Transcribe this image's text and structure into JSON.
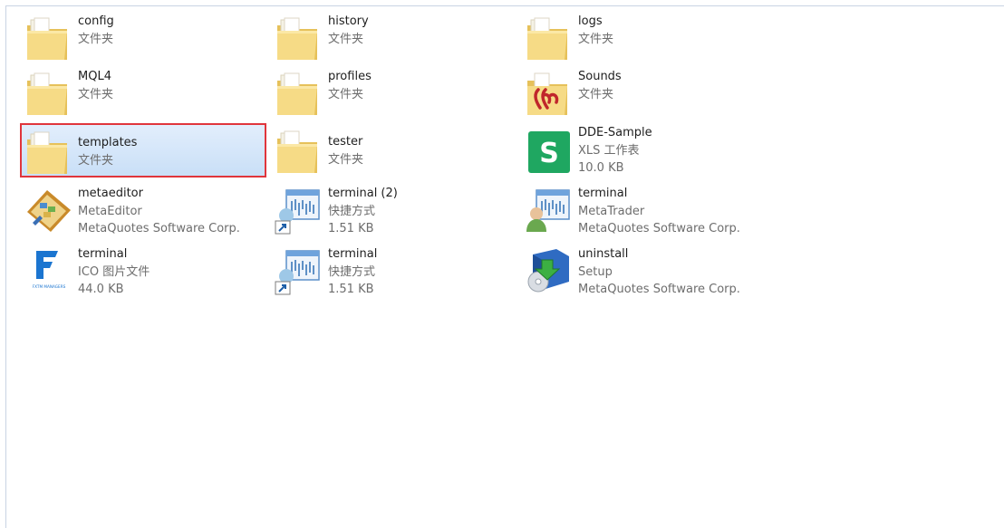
{
  "items": [
    {
      "name": "config",
      "type": "文件夹",
      "icon": "folder-icon"
    },
    {
      "name": "history",
      "type": "文件夹",
      "icon": "folder-icon"
    },
    {
      "name": "logs",
      "type": "文件夹",
      "icon": "folder-icon"
    },
    {
      "name": "MQL4",
      "type": "文件夹",
      "icon": "folder-icon"
    },
    {
      "name": "profiles",
      "type": "文件夹",
      "icon": "folder-icon"
    },
    {
      "name": "Sounds",
      "type": "文件夹",
      "icon": "sounds-folder-icon"
    },
    {
      "name": "templates",
      "type": "文件夹",
      "icon": "folder-icon",
      "selected": true
    },
    {
      "name": "tester",
      "type": "文件夹",
      "icon": "folder-icon"
    },
    {
      "name": "DDE-Sample",
      "type": "XLS 工作表",
      "detail": "10.0 KB",
      "icon": "xls-icon"
    },
    {
      "name": "metaeditor",
      "type": "MetaEditor",
      "detail": "MetaQuotes Software Corp.",
      "icon": "metaeditor-icon"
    },
    {
      "name": "terminal (2)",
      "type": "快捷方式",
      "detail": "1.51 KB",
      "icon": "shortcut-icon"
    },
    {
      "name": "terminal",
      "type": "MetaTrader",
      "detail": "MetaQuotes Software Corp.",
      "icon": "terminal-app-icon"
    },
    {
      "name": "terminal",
      "type": "ICO 图片文件",
      "detail": "44.0 KB",
      "icon": "ico-file-icon"
    },
    {
      "name": "terminal",
      "type": "快捷方式",
      "detail": "1.51 KB",
      "icon": "shortcut-icon"
    },
    {
      "name": "uninstall",
      "type": "Setup",
      "detail": "MetaQuotes Software Corp.",
      "icon": "uninstall-icon"
    }
  ],
  "ico_logo_text": "FXTM MANAGERS",
  "xls_glyph": "S",
  "colors": {
    "selection_border": "#e0353c",
    "selection_fill": "#cfe3f8",
    "folder": "#f1d57a",
    "xls_green": "#1fa761"
  }
}
